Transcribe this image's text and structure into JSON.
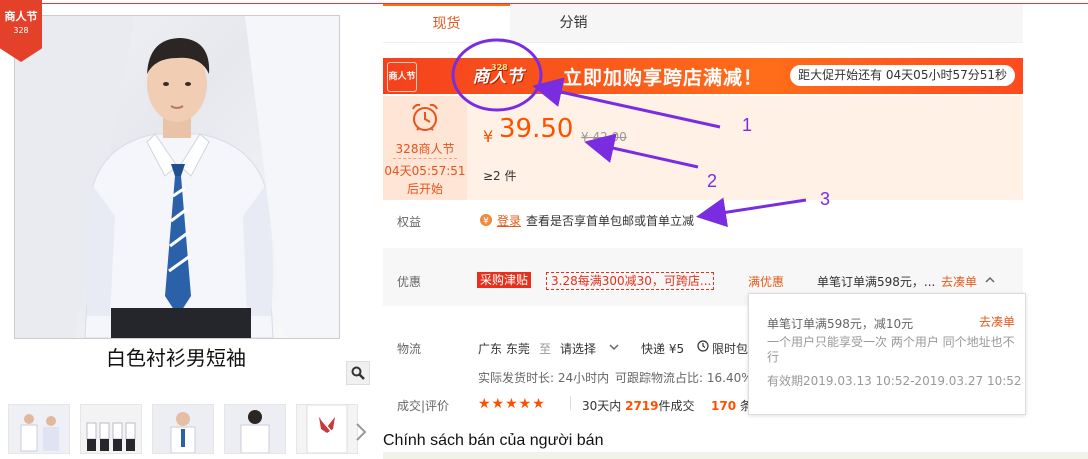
{
  "product": {
    "badge_top": "商人节",
    "badge_bottom": "328",
    "title": "白色衬衫男短袖"
  },
  "tabs": [
    {
      "label": "现货"
    },
    {
      "label": "分销"
    }
  ],
  "promo": {
    "logo_text": "商人节",
    "center_logo_tag": "328",
    "center_logo": "商人节",
    "headline": "立即加购享跨店满减！",
    "countdown": "距大促开始还有 04天05小时57分51秒"
  },
  "event": {
    "name": "328商人节",
    "time": "04天05:57:51",
    "start": "后开始"
  },
  "price": {
    "currency": "¥",
    "value": "39.50",
    "original": "¥ 42.00",
    "moq": "≥2 件"
  },
  "rights": {
    "label": "权益",
    "login": "登录",
    "text": "查看是否享首单包邮或首单立减"
  },
  "discount": {
    "label": "优惠",
    "tag_red": "采购津贴",
    "tag_outline": "3.28每满300减30，可跨店...",
    "full_disc": "满优惠",
    "single_order": "单笔订单满598元，...",
    "collect": "去凑单"
  },
  "popup": {
    "title": "单笔订单满598元，减10元",
    "link": "去凑单",
    "desc": "一个用户只能享受一次 两个用户 同个地址也不行",
    "valid": "有效期2019.03.13 10:52-2019.03.27 10:52"
  },
  "shipping": {
    "label": "物流",
    "from": "广东 东莞",
    "to": "至",
    "select": "请选择",
    "express": "快递 ¥5",
    "limit": "限时包",
    "ship_time": "实际发货时长: 24小时内",
    "trace": "可跟踪物流占比: 16.40%"
  },
  "review": {
    "label": "成交|评价",
    "stars": "★★★★★",
    "deals_prefix": "30天内",
    "deals_count": "2719",
    "deals_suffix": "件成交",
    "evals_count": "170",
    "evals_suffix": "条"
  },
  "policy": {
    "title": "Chính sách bán của người bán"
  },
  "annotations": [
    "1",
    "2",
    "3"
  ],
  "colors": {
    "accent": "#ff5000",
    "annotation": "#7a2de0",
    "tab_active": "#e55a1c"
  }
}
